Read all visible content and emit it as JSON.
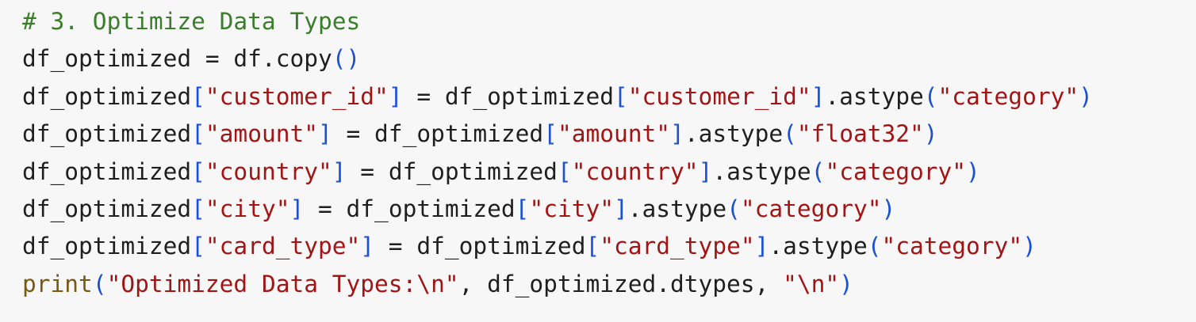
{
  "colors": {
    "background": "#f7f7f7",
    "plain": "#1f1f1f",
    "comment": "#3a7d2a",
    "string": "#a31515",
    "bracket": "#1a4fd6",
    "builtin": "#7a5a12"
  },
  "code": {
    "lines": [
      [
        {
          "t": "comment",
          "v": "# 3. Optimize Data Types"
        }
      ],
      [
        {
          "t": "plain",
          "v": "df_optimized = df.copy"
        },
        {
          "t": "bracket",
          "v": "()"
        }
      ],
      [
        {
          "t": "plain",
          "v": "df_optimized"
        },
        {
          "t": "bracket",
          "v": "["
        },
        {
          "t": "string",
          "v": "\"customer_id\""
        },
        {
          "t": "bracket",
          "v": "]"
        },
        {
          "t": "plain",
          "v": " = df_optimized"
        },
        {
          "t": "bracket",
          "v": "["
        },
        {
          "t": "string",
          "v": "\"customer_id\""
        },
        {
          "t": "bracket",
          "v": "]"
        },
        {
          "t": "plain",
          "v": ".astype"
        },
        {
          "t": "bracket",
          "v": "("
        },
        {
          "t": "string",
          "v": "\"category\""
        },
        {
          "t": "bracket",
          "v": ")"
        }
      ],
      [
        {
          "t": "plain",
          "v": "df_optimized"
        },
        {
          "t": "bracket",
          "v": "["
        },
        {
          "t": "string",
          "v": "\"amount\""
        },
        {
          "t": "bracket",
          "v": "]"
        },
        {
          "t": "plain",
          "v": " = df_optimized"
        },
        {
          "t": "bracket",
          "v": "["
        },
        {
          "t": "string",
          "v": "\"amount\""
        },
        {
          "t": "bracket",
          "v": "]"
        },
        {
          "t": "plain",
          "v": ".astype"
        },
        {
          "t": "bracket",
          "v": "("
        },
        {
          "t": "string",
          "v": "\"float32\""
        },
        {
          "t": "bracket",
          "v": ")"
        }
      ],
      [
        {
          "t": "plain",
          "v": "df_optimized"
        },
        {
          "t": "bracket",
          "v": "["
        },
        {
          "t": "string",
          "v": "\"country\""
        },
        {
          "t": "bracket",
          "v": "]"
        },
        {
          "t": "plain",
          "v": " = df_optimized"
        },
        {
          "t": "bracket",
          "v": "["
        },
        {
          "t": "string",
          "v": "\"country\""
        },
        {
          "t": "bracket",
          "v": "]"
        },
        {
          "t": "plain",
          "v": ".astype"
        },
        {
          "t": "bracket",
          "v": "("
        },
        {
          "t": "string",
          "v": "\"category\""
        },
        {
          "t": "bracket",
          "v": ")"
        }
      ],
      [
        {
          "t": "plain",
          "v": "df_optimized"
        },
        {
          "t": "bracket",
          "v": "["
        },
        {
          "t": "string",
          "v": "\"city\""
        },
        {
          "t": "bracket",
          "v": "]"
        },
        {
          "t": "plain",
          "v": " = df_optimized"
        },
        {
          "t": "bracket",
          "v": "["
        },
        {
          "t": "string",
          "v": "\"city\""
        },
        {
          "t": "bracket",
          "v": "]"
        },
        {
          "t": "plain",
          "v": ".astype"
        },
        {
          "t": "bracket",
          "v": "("
        },
        {
          "t": "string",
          "v": "\"category\""
        },
        {
          "t": "bracket",
          "v": ")"
        }
      ],
      [
        {
          "t": "plain",
          "v": "df_optimized"
        },
        {
          "t": "bracket",
          "v": "["
        },
        {
          "t": "string",
          "v": "\"card_type\""
        },
        {
          "t": "bracket",
          "v": "]"
        },
        {
          "t": "plain",
          "v": " = df_optimized"
        },
        {
          "t": "bracket",
          "v": "["
        },
        {
          "t": "string",
          "v": "\"card_type\""
        },
        {
          "t": "bracket",
          "v": "]"
        },
        {
          "t": "plain",
          "v": ".astype"
        },
        {
          "t": "bracket",
          "v": "("
        },
        {
          "t": "string",
          "v": "\"category\""
        },
        {
          "t": "bracket",
          "v": ")"
        }
      ],
      [
        {
          "t": "builtin",
          "v": "print"
        },
        {
          "t": "bracket",
          "v": "("
        },
        {
          "t": "string",
          "v": "\"Optimized Data Types:\\n\""
        },
        {
          "t": "plain",
          "v": ", df_optimized.dtypes, "
        },
        {
          "t": "string",
          "v": "\"\\n\""
        },
        {
          "t": "bracket",
          "v": ")"
        }
      ]
    ]
  }
}
